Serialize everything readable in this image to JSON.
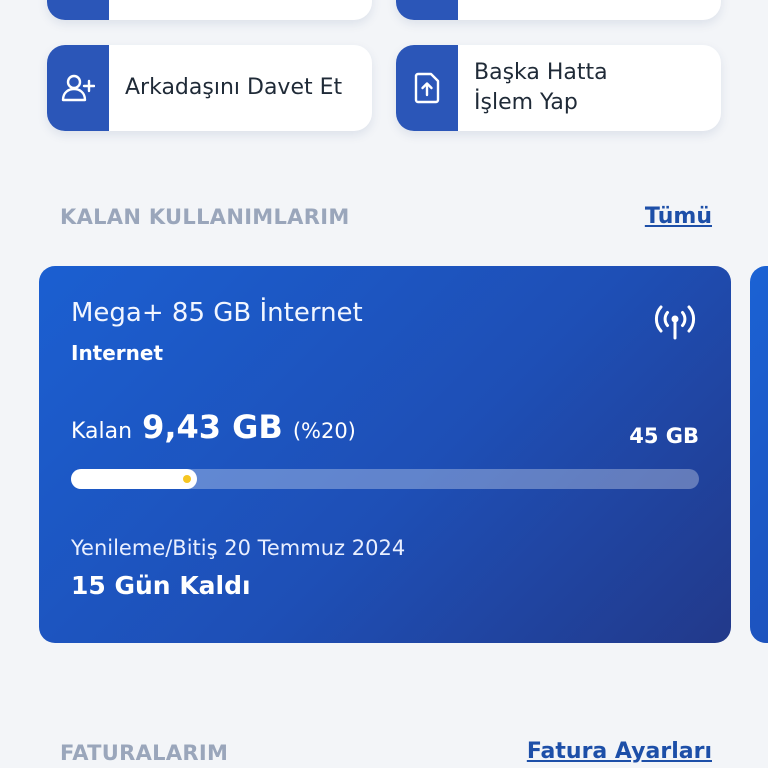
{
  "quick_actions": [
    {
      "label": "",
      "icon": "unknown-icon"
    },
    {
      "label": "",
      "icon": "unknown-icon"
    },
    {
      "label": "Arkadaşını Davet Et",
      "icon": "add-user-icon"
    },
    {
      "label": "Başka Hatta\nİşlem Yap",
      "icon": "upload-file-icon"
    }
  ],
  "remaining_usage": {
    "title": "KALAN KULLANIMLARIM",
    "link": "Tümü",
    "card": {
      "package_name": "Mega+ 85 GB İnternet",
      "type": "Internet",
      "remaining_label": "Kalan",
      "remaining_value": "9,43 GB",
      "remaining_percent_text": "(%20)",
      "remaining_fraction": 0.2,
      "total": "45 GB",
      "renewal_text": "Yenileme/Bitiş 20 Temmuz 2024",
      "days_left": "15 Gün Kaldı",
      "icon": "signal-antenna-icon"
    }
  },
  "bills": {
    "title": "FATURALARIM",
    "link": "Fatura Ayarları"
  },
  "colors": {
    "accent": "#2b56b8",
    "card_gradient_start": "#1b5fd1",
    "card_gradient_end": "#22398a",
    "background": "#f3f5f8",
    "progress_dot": "#f6c622"
  }
}
